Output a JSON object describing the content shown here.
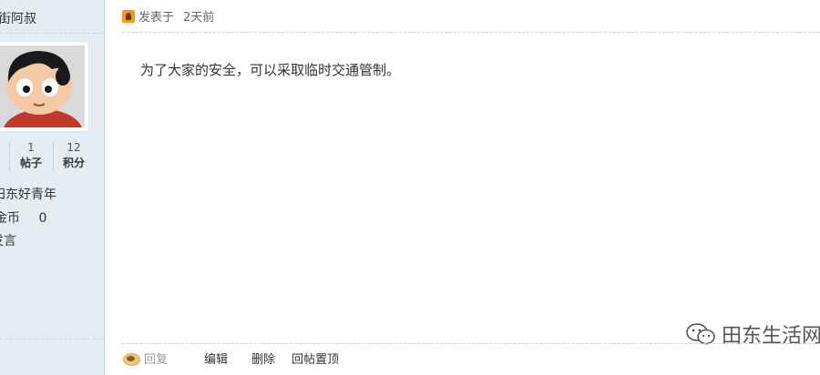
{
  "user": {
    "name": "街阿叔",
    "stats": [
      {
        "value": "1",
        "label": "帖子"
      },
      {
        "value": "12",
        "label": "积分"
      }
    ],
    "group": "田东好青年",
    "coin_label": "金币",
    "coin_value": "0",
    "send_msg": "发言"
  },
  "post": {
    "posted_label": "发表于",
    "posted_time": "2天前",
    "content": "为了大家的安全，可以采取临时交通管制。"
  },
  "actions": {
    "reply": "回复",
    "edit": "编辑",
    "delete": "删除",
    "pin": "回帖置顶"
  },
  "watermark": "田东生活网"
}
